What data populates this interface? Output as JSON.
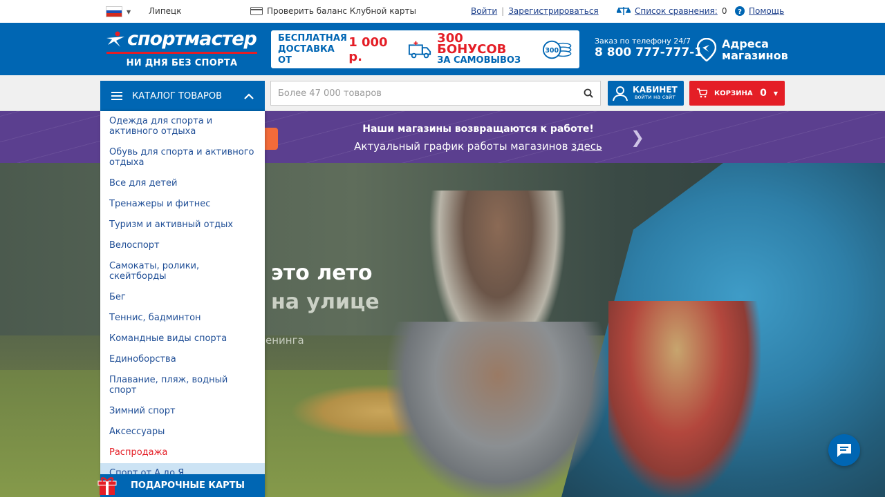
{
  "topbar": {
    "city": "Липецк",
    "card_check": "Проверить баланс Клубной карты",
    "login": "Войти",
    "divider": "|",
    "register": "Зарегистрироваться",
    "compare_label": "Список сравнения:",
    "compare_count": "0",
    "help": "Помощь"
  },
  "header": {
    "logo_text": "спортмастер",
    "slogan": "НИ ДНЯ БЕЗ СПОРТА",
    "promo": {
      "delivery_line1": "БЕСПЛАТНАЯ",
      "delivery_line2": "ДОСТАВКА ОТ",
      "delivery_amount": "1 000 р.",
      "bonus_big": "300 БОНУСОВ",
      "bonus_small": "ЗА САМОВЫВОЗ",
      "coin_value": "300"
    },
    "phone_label": "Заказ по телефону 24/7",
    "phone_number": "8 800 777-777-1",
    "stores_line1": "Адреса",
    "stores_line2": "магазинов"
  },
  "nav": {
    "catalog_label": "КАТАЛОГ ТОВАРОВ",
    "search_placeholder": "Более 47 000 товаров",
    "cabinet_title": "КАБИНЕТ",
    "cabinet_sub": "войти на сайт",
    "cart_label": "КОРЗИНА",
    "cart_count": "0"
  },
  "banner": {
    "title": "Наши магазины возвращаются к работе!",
    "text": "Актуальный график работы магазинов",
    "link": "здесь"
  },
  "hero": {
    "line1": "это лето",
    "line2": "на улице",
    "line3": "енинга"
  },
  "menu": {
    "items": [
      {
        "label": "Одежда для спорта и активного отдыха"
      },
      {
        "label": "Обувь для спорта и активного отдыха"
      },
      {
        "label": "Все для детей"
      },
      {
        "label": "Тренажеры и фитнес"
      },
      {
        "label": "Туризм и активный отдых"
      },
      {
        "label": "Велоспорт"
      },
      {
        "label": "Самокаты, ролики, скейтборды"
      },
      {
        "label": "Бег"
      },
      {
        "label": "Теннис, бадминтон"
      },
      {
        "label": "Командные виды спорта"
      },
      {
        "label": "Единоборства"
      },
      {
        "label": "Плавание, пляж, водный спорт"
      },
      {
        "label": "Зимний спорт"
      },
      {
        "label": "Аксессуары"
      },
      {
        "label": "Распродажа"
      },
      {
        "label": "Спорт от А до Я"
      }
    ],
    "gift_cards": "ПОДАРОЧНЫЕ КАРТЫ"
  },
  "colors": {
    "brand_blue": "#0066b3",
    "accent_red": "#e41e26",
    "banner_purple": "#5b3f8f"
  }
}
